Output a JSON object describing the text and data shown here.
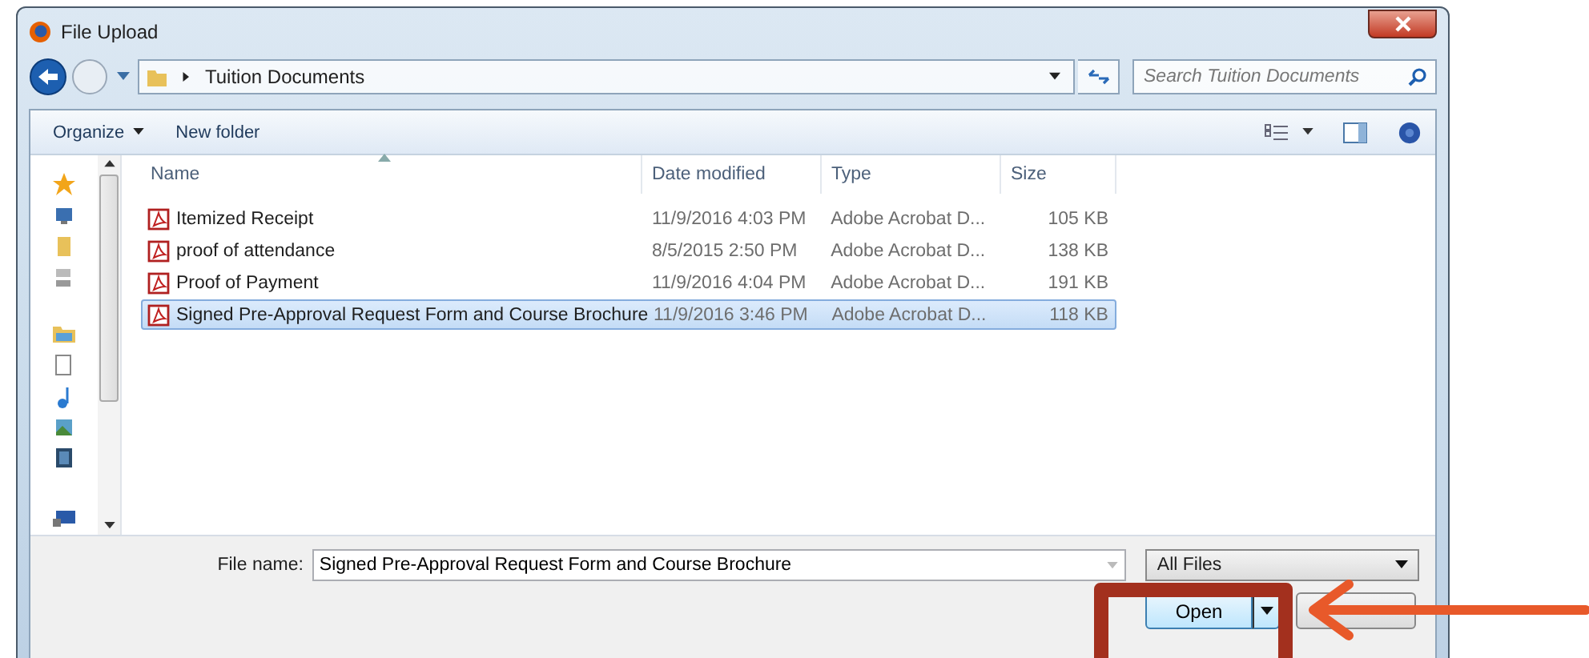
{
  "window": {
    "title": "File Upload"
  },
  "address_bar": {
    "path": "Tuition Documents"
  },
  "search": {
    "placeholder": "Search Tuition Documents"
  },
  "toolbar": [
    {
      "label": "Organize",
      "kind": "menu"
    },
    {
      "label": "New folder",
      "kind": "button"
    }
  ],
  "table": {
    "columns": [
      {
        "label": "Name",
        "sorted": true
      },
      {
        "label": "Date modified",
        "sorted": false
      },
      {
        "label": "Type",
        "sorted": false
      },
      {
        "label": "Size",
        "sorted": false
      }
    ],
    "rows": [
      {
        "name": "Itemized Receipt",
        "date": "11/9/2016 4:03 PM",
        "type": "Adobe Acrobat D...",
        "size": "105 KB",
        "selected": false
      },
      {
        "name": "proof of attendance",
        "date": "8/5/2015 2:50 PM",
        "type": "Adobe Acrobat D...",
        "size": "138 KB",
        "selected": false
      },
      {
        "name": "Proof of Payment",
        "date": "11/9/2016 4:04 PM",
        "type": "Adobe Acrobat D...",
        "size": "191 KB",
        "selected": false
      },
      {
        "name": "Signed Pre-Approval Request Form and Course Brochure",
        "date": "11/9/2016 3:46 PM",
        "type": "Adobe Acrobat D...",
        "size": "118 KB",
        "selected": true
      }
    ]
  },
  "file_name": {
    "label": "File name:",
    "value": "Signed Pre-Approval Request Form and Course Brochure"
  },
  "file_type": {
    "value": "All Files"
  },
  "open_button": {
    "label": "Open"
  }
}
